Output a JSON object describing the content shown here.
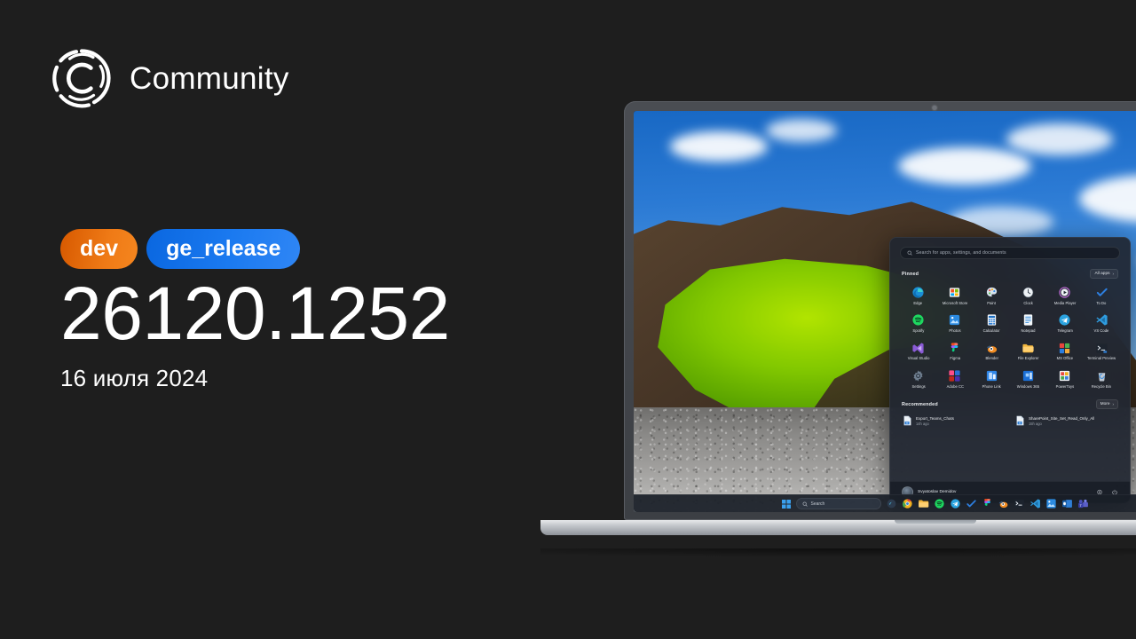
{
  "brand": {
    "name": "Community",
    "logo_icon": "community-circle-c-icon"
  },
  "release": {
    "badges": [
      {
        "label": "dev",
        "color_from": "#d75900",
        "color_to": "#f5861f"
      },
      {
        "label": "ge_release",
        "color_from": "#0a67e0",
        "color_to": "#2f86f5"
      }
    ],
    "version": "26120.1252",
    "date": "16 июля 2024"
  },
  "desktop": {
    "start_menu": {
      "search_placeholder": "Search for apps, settings, and documents",
      "pinned_title": "Pinned",
      "all_apps_label": "All apps",
      "recommended_title": "Recommended",
      "more_label": "More",
      "pinned": [
        {
          "label": "Edge",
          "icon": "edge-icon"
        },
        {
          "label": "Microsoft Store",
          "icon": "microsoft-store-icon"
        },
        {
          "label": "Paint",
          "icon": "paint-icon"
        },
        {
          "label": "Clock",
          "icon": "clock-icon"
        },
        {
          "label": "Media Player",
          "icon": "media-player-icon"
        },
        {
          "label": "To Do",
          "icon": "to-do-icon"
        },
        {
          "label": "Spotify",
          "icon": "spotify-icon"
        },
        {
          "label": "Photos",
          "icon": "photos-icon"
        },
        {
          "label": "Calculator",
          "icon": "calculator-icon"
        },
        {
          "label": "Notepad",
          "icon": "notepad-icon"
        },
        {
          "label": "Telegram",
          "icon": "telegram-icon"
        },
        {
          "label": "VS Code",
          "icon": "vs-code-icon"
        },
        {
          "label": "Visual Studio",
          "icon": "visual-studio-icon"
        },
        {
          "label": "Figma",
          "icon": "figma-icon"
        },
        {
          "label": "Blender",
          "icon": "blender-icon"
        },
        {
          "label": "File Explorer",
          "icon": "file-explorer-icon"
        },
        {
          "label": "MS Office",
          "icon": "ms-office-icon"
        },
        {
          "label": "Terminal Preview",
          "icon": "terminal-preview-icon"
        },
        {
          "label": "Settings",
          "icon": "settings-gear-icon"
        },
        {
          "label": "Adobe CC",
          "icon": "adobe-cc-icon"
        },
        {
          "label": "Phone Link",
          "icon": "phone-link-icon"
        },
        {
          "label": "Windows 365",
          "icon": "windows-365-icon"
        },
        {
          "label": "PowerToys",
          "icon": "powertoys-icon"
        },
        {
          "label": "Recycle Bin",
          "icon": "recycle-bin-icon"
        }
      ],
      "recommended": [
        {
          "title": "Export_Teams_Chats",
          "subtitle": "14h ago",
          "icon": "document-icon"
        },
        {
          "title": "SharePoint_Site_Set_Read_Only_All",
          "subtitle": "15h ago",
          "icon": "document-icon"
        }
      ],
      "account": {
        "name": "Svyatoslav Demidov",
        "avatar_icon": "avatar",
        "settings_icon": "gear-icon",
        "power_icon": "power-icon"
      }
    },
    "taskbar": {
      "start_icon": "windows-start-icon",
      "search_placeholder": "Search",
      "search_icon": "search-icon",
      "pinned_icons": [
        "copilot-icon",
        "chrome-icon",
        "file-explorer-icon",
        "spotify-icon",
        "telegram-icon",
        "to-do-icon",
        "figma-icon",
        "blender-icon",
        "terminal-icon",
        "vs-code-icon",
        "photos-icon",
        "outlook-icon",
        "teams-icon"
      ]
    }
  },
  "theme": {
    "background": "#1e1e1e",
    "text": "#ffffff"
  }
}
